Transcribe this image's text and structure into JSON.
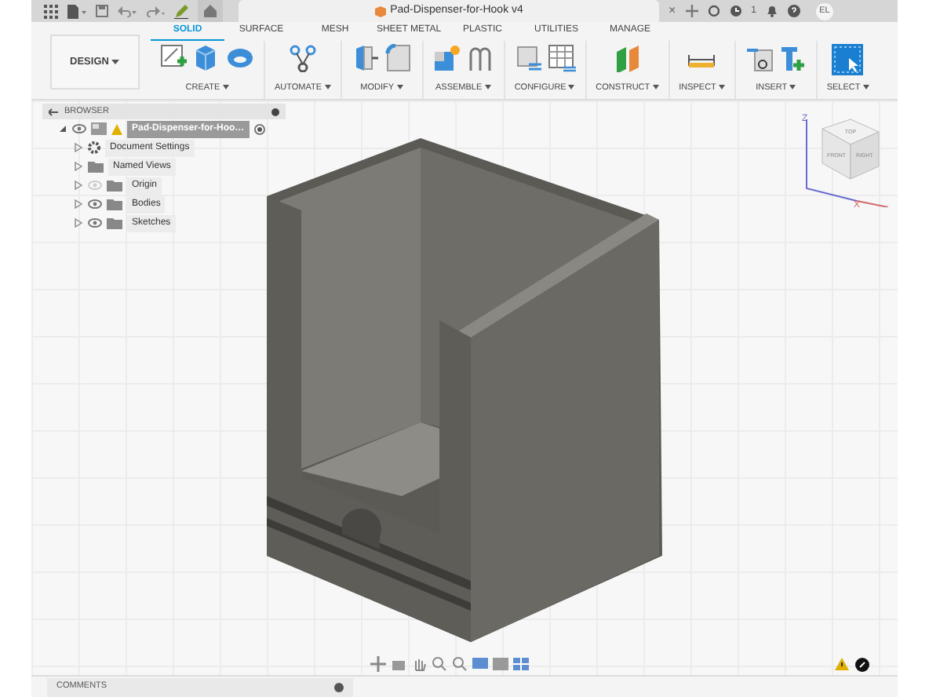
{
  "top_bar": {
    "title": "Pad-Dispenser-for-Hook v4",
    "close": "×",
    "job_count": "1",
    "avatar": "EL"
  },
  "workspace": {
    "label": "DESIGN"
  },
  "tabs": [
    {
      "label": "SOLID",
      "selected": true
    },
    {
      "label": "SURFACE",
      "selected": false
    },
    {
      "label": "MESH",
      "selected": false
    },
    {
      "label": "SHEET METAL",
      "selected": false
    },
    {
      "label": "PLASTIC",
      "selected": false
    },
    {
      "label": "UTILITIES",
      "selected": false
    },
    {
      "label": "MANAGE",
      "selected": false
    }
  ],
  "tool_groups": [
    {
      "label": "CREATE"
    },
    {
      "label": "AUTOMATE"
    },
    {
      "label": "MODIFY"
    },
    {
      "label": "ASSEMBLE"
    },
    {
      "label": "CONFIGURE"
    },
    {
      "label": "CONSTRUCT"
    },
    {
      "label": "INSPECT"
    },
    {
      "label": "INSERT"
    },
    {
      "label": "SELECT"
    }
  ],
  "browser": {
    "title": "BROWSER",
    "root": {
      "label": "Pad-Dispenser-for-Hoo…",
      "expanded": true,
      "selected": true,
      "visible": true,
      "warning": true,
      "children": [
        {
          "kind": "settings",
          "label": "Document Settings",
          "expanded": false,
          "selected": false
        },
        {
          "kind": "folder",
          "label": "Named Views",
          "expanded": false,
          "selected": false
        },
        {
          "kind": "folder",
          "label": "Origin",
          "expanded": false,
          "selected": false,
          "visible": false
        },
        {
          "kind": "folder",
          "label": "Bodies",
          "expanded": false,
          "selected": false,
          "visible": true
        },
        {
          "kind": "folder",
          "label": "Sketches",
          "expanded": false,
          "selected": false,
          "visible": true
        }
      ]
    }
  },
  "view_cube": {
    "faces": [
      "TOP",
      "FRONT",
      "RIGHT"
    ],
    "axes": [
      "Z",
      "X"
    ]
  },
  "comments": {
    "label": "COMMENTS"
  }
}
